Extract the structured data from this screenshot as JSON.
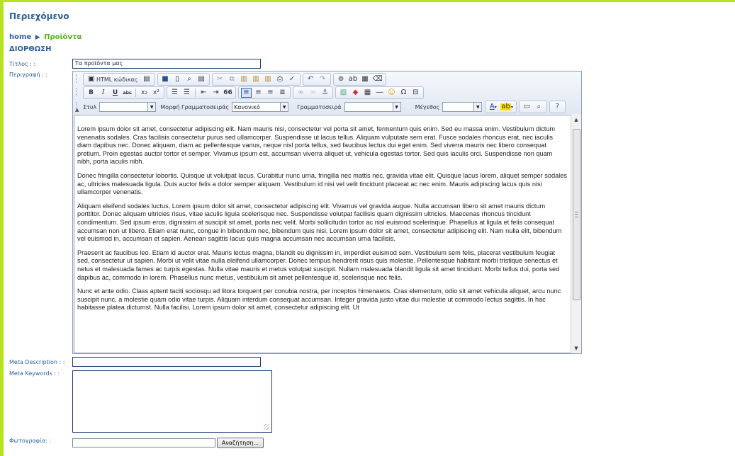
{
  "page": {
    "title": "Περιεχόμενο",
    "section_title": "ΔΙΟΡΘΩΣΗ"
  },
  "breadcrumb": {
    "home": "home",
    "separator": "▶",
    "current": "Προϊόντα"
  },
  "form": {
    "title_label": "Τίτλος : :",
    "title_value": "Τα προϊόντα μας",
    "description_label": "Περιγραφή : :",
    "meta_description_label": "Meta Description : :",
    "meta_description_value": "",
    "meta_keywords_label": "Meta Keywords : :",
    "meta_keywords_value": "",
    "photo_label": "Φωτογραφία: :",
    "browse_label": "Αναζήτηση..."
  },
  "editor": {
    "source_label": "HTML κώδικας",
    "style_label": "Στυλ",
    "style_value": "",
    "format_label": "Μορφή Γραμματοσειράς",
    "format_value": "Κανονικό",
    "font_label": "Γραμματοσειρά",
    "font_value": "",
    "size_label": "Μέγεθος",
    "size_value": "",
    "bold": "B",
    "italic": "I",
    "underline": "U",
    "strike": "abc",
    "subscript": "x₂",
    "superscript": "x²",
    "quote": "66",
    "paragraphs": [
      "Lorem ipsum dolor sit amet, consectetur adipiscing elit. Nam mauris nisi, consectetur vel porta sit amet, fermentum quis enim. Sed eu massa enim. Vestibulum dictum venenatis sodales. Cras facilisis consectetur purus sed ullamcorper. Suspendisse ut lacus tellus. Aliquam vulputate sem erat. Fusce sodales rhoncus erat, nec iaculis diam dapibus nec. Donec aliquam, diam ac pellentesque varius, neque nisl porta tellus, sed faucibus lectus dui eget enim. Sed viverra mauris nec libero consequat pretium. Proin egestas auctor tortor et semper. Vivamus ipsum est, accumsan viverra aliquet ut, vehicula egestas tortor. Sed quis iaculis orci. Suspendisse non quam nibh, porta iaculis nibh.",
      "Donec fringilla consectetur lobortis. Quisque ut volutpat lacus. Curabitur nunc urna, fringilla nec mattis nec, gravida vitae elit. Quisque lacus lorem, aliquet semper sodales ac, ultricies malesuada ligula. Duis auctor felis a dolor semper aliquam. Vestibulum id nisi vel velit tincidunt placerat ac nec enim. Mauris adipiscing lacus quis nisi ullamcorper venenatis.",
      "Aliquam eleifend sodales luctus. Lorem ipsum dolor sit amet, consectetur adipiscing elit. Vivamus vel gravida augue. Nulla accumsan libero sit amet mauris dictum porttitor. Donec aliquam ultricies risus, vitae iaculis ligula scelerisque nec. Suspendisse volutpat facilisis quam dignissim ultricies. Maecenas rhoncus tincidunt condimentum. Sed ipsum eros, dignissim at suscipit sit amet, porta nec velit. Morbi sollicitudin tortor ac nisl euismod scelerisque. Phasellus at ligula et felis consequat accumsan non ut libero. Etiam erat nunc, congue in bibendum nec, bibendum quis nisi. Lorem ipsum dolor sit amet, consectetur adipiscing elit. Nam nulla elit, bibendum vel euismod in, accumsan et sapien. Aenean sagittis lacus quis magna accumsan nec accumsan urna facilisis.",
      "Praesent ac faucibus leo. Etiam id auctor erat. Mauris lectus magna, blandit eu dignissim in, imperdiet euismod sem. Vestibulum sem felis, placerat vestibulum feugiat sed, consectetur ut sapien. Morbi ut velit vitae nulla eleifend ullamcorper. Donec tempus hendrerit risus quis molestie. Pellentesque habitant morbi tristique senectus et netus et malesuada fames ac turpis egestas. Nulla vitae mauris et metus volutpat suscipit. Nullam malesuada blandit ligula sit amet tincidunt. Morbi tellus dui, porta sed dapibus ac, commodo in lorem. Phasellus nunc metus, vestibulum sit amet pellentesque id, scelerisque nec felis.",
      "Nunc et ante odio. Class aptent taciti sociosqu ad litora torquent per conubia nostra, per inceptos himenaeos. Cras elementum, odio sit amet vehicula aliquet, arcu nunc suscipit nunc, a molestie quam odio vitae turpis. Aliquam interdum consequat accumsan. Integer gravida justo vitae dui molestie ut commodo lectus sagittis. In hac habitasse platea dictumst. Nulla facilisi. Lorem ipsum dolor sit amet, consectetur adipiscing elit. Ut"
    ]
  },
  "colors": {
    "accent_green": "#b6e21f",
    "heading_blue": "#2e5f9a",
    "breadcrumb_green": "#55b21a"
  }
}
